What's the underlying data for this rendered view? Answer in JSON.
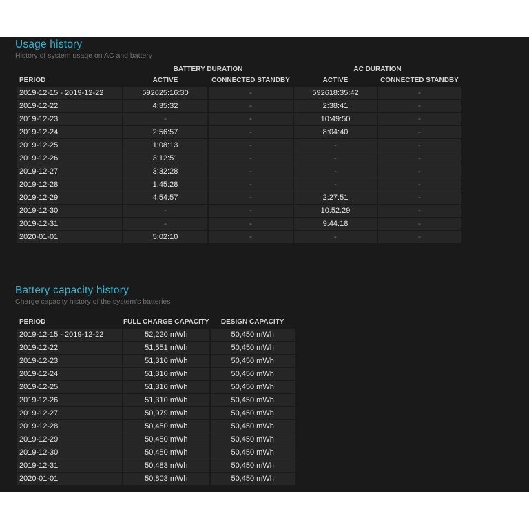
{
  "usage": {
    "title": "Usage history",
    "subtitle": "History of system usage on AC and battery",
    "group_battery": "BATTERY DURATION",
    "group_ac": "AC DURATION",
    "columns": [
      "PERIOD",
      "ACTIVE",
      "CONNECTED STANDBY",
      "ACTIVE",
      "CONNECTED STANDBY"
    ],
    "rows": [
      [
        "2019-12-15 - 2019-12-22",
        "592625:16:30",
        "-",
        "592618:35:42",
        "-"
      ],
      [
        "2019-12-22",
        "4:35:32",
        "-",
        "2:38:41",
        "-"
      ],
      [
        "2019-12-23",
        "-",
        "-",
        "10:49:50",
        "-"
      ],
      [
        "2019-12-24",
        "2:56:57",
        "-",
        "8:04:40",
        "-"
      ],
      [
        "2019-12-25",
        "1:08:13",
        "-",
        "-",
        "-"
      ],
      [
        "2019-12-26",
        "3:12:51",
        "-",
        "-",
        "-"
      ],
      [
        "2019-12-27",
        "3:32:28",
        "-",
        "-",
        "-"
      ],
      [
        "2019-12-28",
        "1:45:28",
        "-",
        "-",
        "-"
      ],
      [
        "2019-12-29",
        "4:54:57",
        "-",
        "2:27:51",
        "-"
      ],
      [
        "2019-12-30",
        "-",
        "-",
        "10:52:29",
        "-"
      ],
      [
        "2019-12-31",
        "-",
        "-",
        "9:44:18",
        "-"
      ],
      [
        "2020-01-01",
        "5:02:10",
        "-",
        "-",
        "-"
      ]
    ]
  },
  "capacity": {
    "title": "Battery capacity history",
    "subtitle": "Charge capacity history of the system's batteries",
    "columns": [
      "PERIOD",
      "FULL CHARGE CAPACITY",
      "DESIGN CAPACITY"
    ],
    "rows": [
      [
        "2019-12-15 - 2019-12-22",
        "52,220 mWh",
        "50,450 mWh"
      ],
      [
        "2019-12-22",
        "51,551 mWh",
        "50,450 mWh"
      ],
      [
        "2019-12-23",
        "51,310 mWh",
        "50,450 mWh"
      ],
      [
        "2019-12-24",
        "51,310 mWh",
        "50,450 mWh"
      ],
      [
        "2019-12-25",
        "51,310 mWh",
        "50,450 mWh"
      ],
      [
        "2019-12-26",
        "51,310 mWh",
        "50,450 mWh"
      ],
      [
        "2019-12-27",
        "50,979 mWh",
        "50,450 mWh"
      ],
      [
        "2019-12-28",
        "50,450 mWh",
        "50,450 mWh"
      ],
      [
        "2019-12-29",
        "50,450 mWh",
        "50,450 mWh"
      ],
      [
        "2019-12-30",
        "50,450 mWh",
        "50,450 mWh"
      ],
      [
        "2019-12-31",
        "50,483 mWh",
        "50,450 mWh"
      ],
      [
        "2020-01-01",
        "50,803 mWh",
        "50,450 mWh"
      ]
    ]
  },
  "colors": {
    "accent": "#2fb7d4",
    "background": "#1a1a1a",
    "cell": "#262626"
  }
}
